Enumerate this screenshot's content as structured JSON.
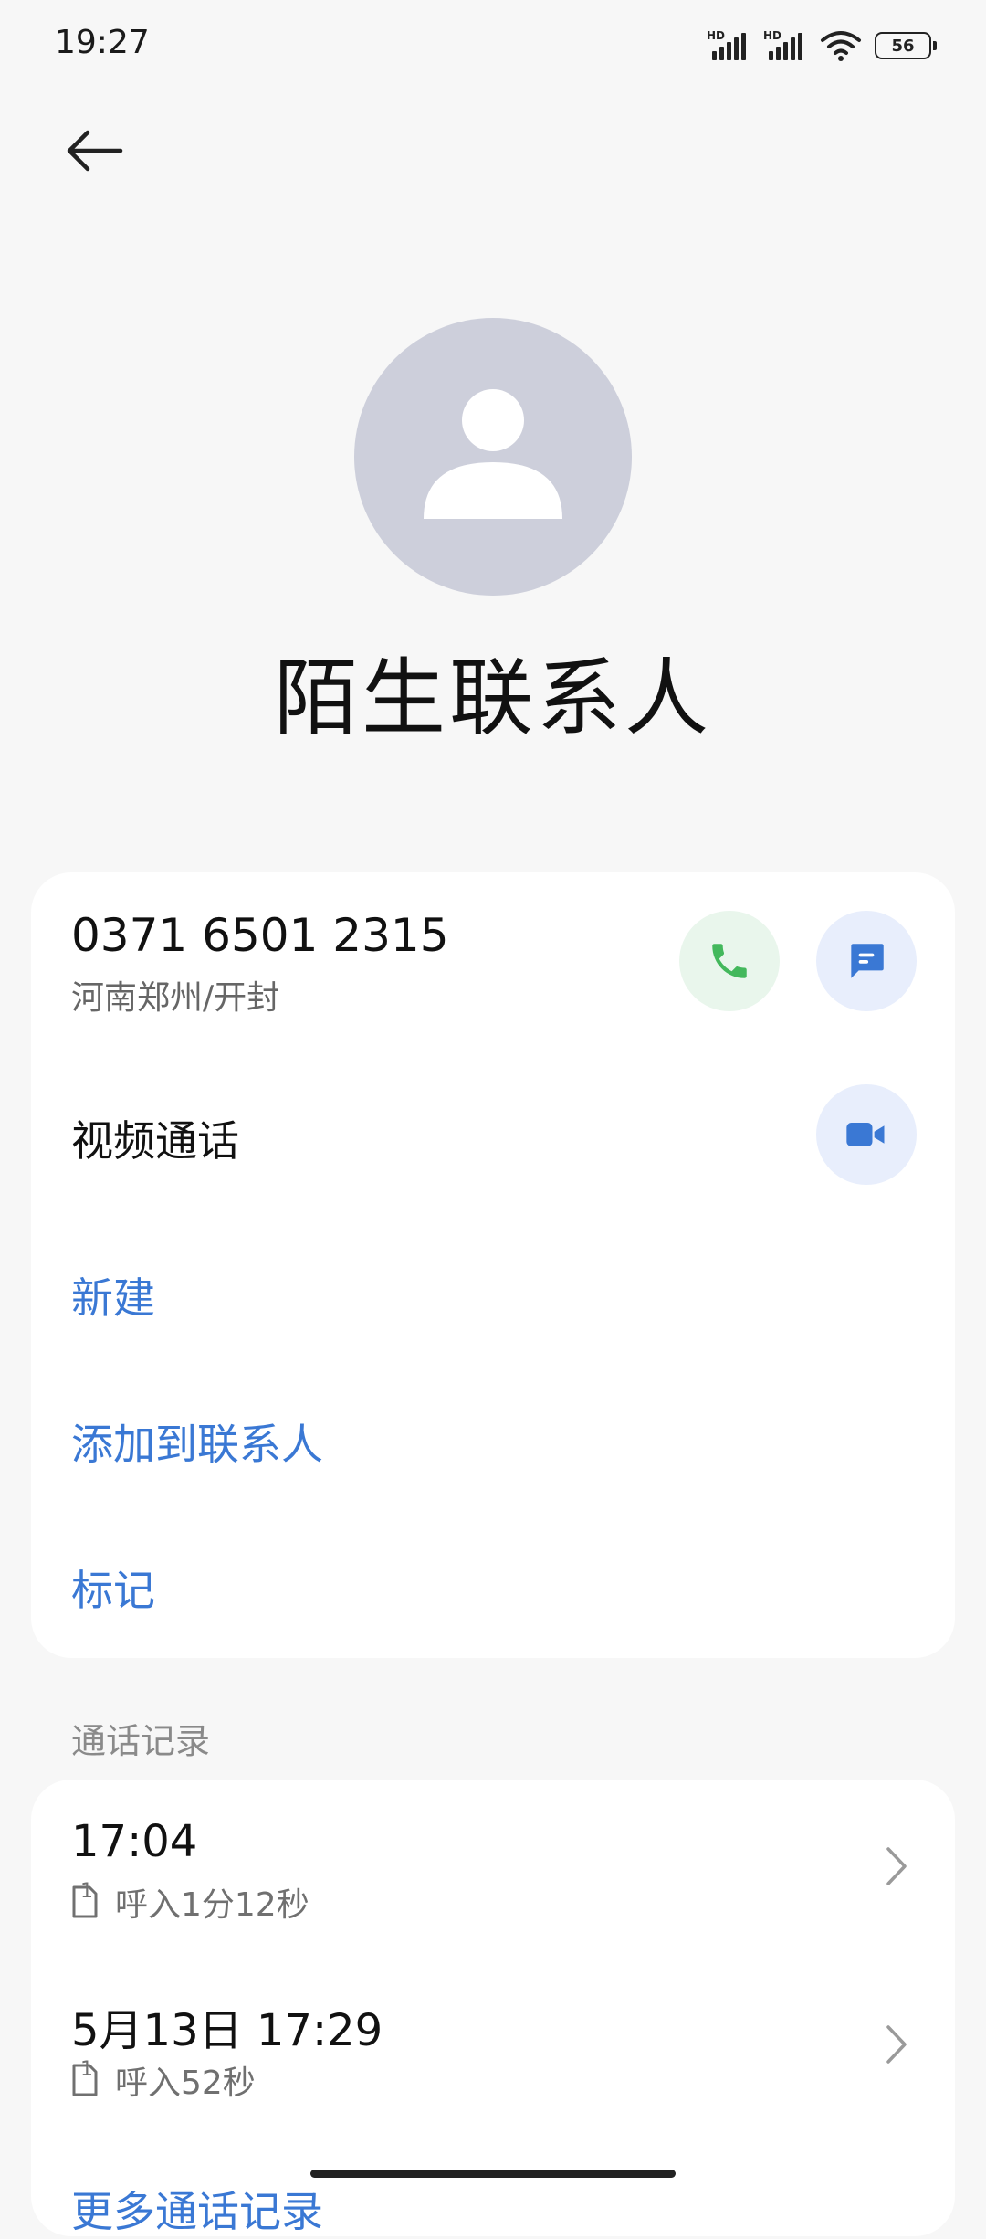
{
  "status_bar": {
    "time": "19:27",
    "signal1_label": "HD",
    "signal2_label": "HD",
    "battery": "56"
  },
  "contact": {
    "name": "陌生联系人"
  },
  "main_card": {
    "phone_number": "0371 6501 2315",
    "location": "河南郑州/开封",
    "video_call_label": "视频通话",
    "new_label": "新建",
    "add_to_contacts_label": "添加到联系人",
    "mark_label": "标记"
  },
  "call_log": {
    "section_title": "通话记录",
    "entries": [
      {
        "time": "17:04",
        "sim": "1",
        "detail": "呼入1分12秒"
      },
      {
        "time": "5月13日 17:29",
        "sim": "1",
        "detail": "呼入52秒"
      }
    ],
    "more_label": "更多通话记录"
  },
  "colors": {
    "accent_blue": "#3a78d4",
    "call_green": "#43b85c",
    "avatar_bg": "#cdcfdb"
  }
}
